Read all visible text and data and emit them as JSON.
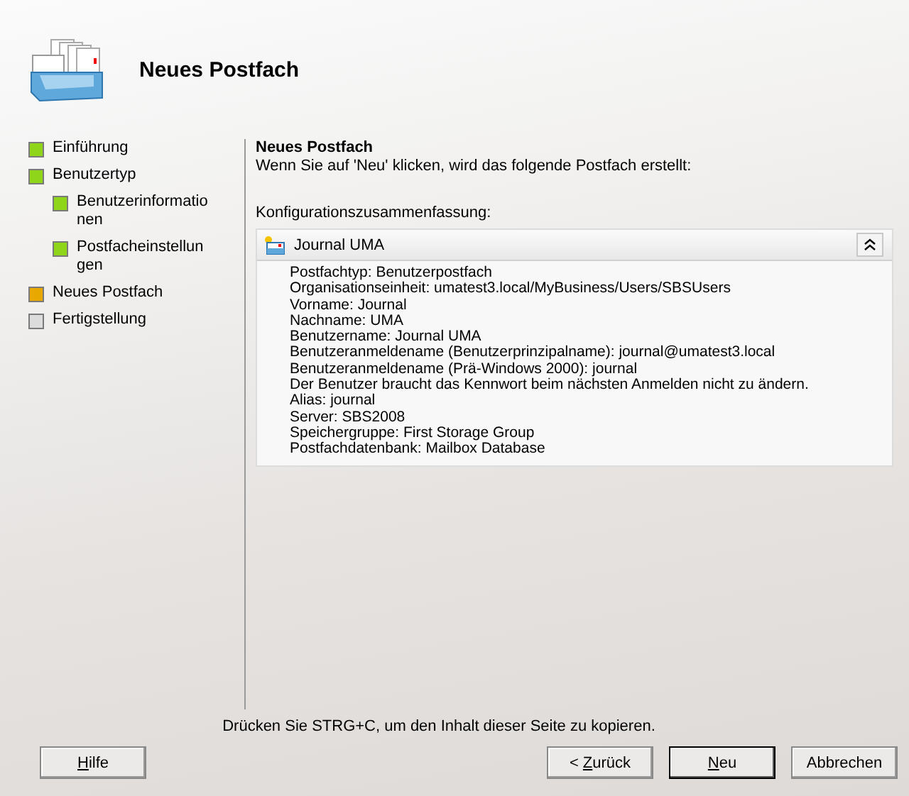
{
  "header": {
    "title": "Neues Postfach"
  },
  "steps": [
    {
      "label": "Einführung",
      "completed": true,
      "current": false
    },
    {
      "label": "Benutzertyp",
      "completed": true,
      "current": false,
      "children": [
        {
          "label": "Benutzerinformationen",
          "completed": true,
          "current": false
        },
        {
          "label": "Postfacheinstellungen",
          "completed": true,
          "current": false
        }
      ]
    },
    {
      "label": "Neues Postfach",
      "current": true
    },
    {
      "label": "Fertigstellung",
      "completed": false,
      "current": false
    }
  ],
  "page": {
    "title": "Neues Postfach",
    "description": "Wenn Sie auf 'Neu' klicken, wird das folgende Postfach erstellt:",
    "summary_label": "Konfigurationszusammenfassung:"
  },
  "summary": {
    "title": "Journal UMA",
    "expanded": true,
    "lines": [
      "Postfachtyp: Benutzerpostfach",
      "Organisationseinheit: umatest3.local/MyBusiness/Users/SBSUsers",
      "Vorname: Journal",
      "Nachname: UMA",
      "Benutzername: Journal UMA",
      "Benutzeranmeldename (Benutzerprinzipalname): journal@umatest3.local",
      "Benutzeranmeldename (Prä-Windows 2000): journal",
      "Der Benutzer braucht das Kennwort beim nächsten Anmelden nicht zu ändern.",
      "Alias: journal",
      "Server: SBS2008",
      "Speichergruppe: First Storage Group",
      "Postfachdatenbank: Mailbox Database"
    ]
  },
  "hint": "Drücken Sie STRG+C, um den Inhalt dieser Seite zu kopieren.",
  "buttons": [
    {
      "access_key": "H",
      "text_after": "ilfe",
      "default": false
    },
    {
      "text_before": "< ",
      "access_key": "Z",
      "text_after": "urück",
      "default": false
    },
    {
      "access_key": "N",
      "text_after": "eu",
      "default": true
    },
    {
      "text_before": "Abbrechen",
      "default": false
    }
  ]
}
